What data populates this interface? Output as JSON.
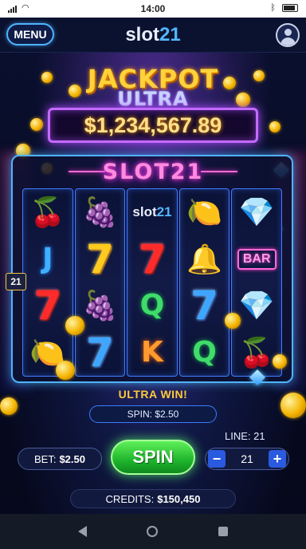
{
  "status": {
    "time": "14:00"
  },
  "header": {
    "menu_label": "MENU",
    "logo_part1": "slot",
    "logo_part2": "21"
  },
  "jackpot": {
    "title": "JACKPOT",
    "subtitle": "ULTRA",
    "amount": "$1,234,567.89"
  },
  "machine": {
    "title": "SLOT21",
    "reels": [
      [
        {
          "type": "fruit",
          "name": "cherries-symbol",
          "glyph": "🍒"
        },
        {
          "type": "letter",
          "text": "J",
          "color": "blue"
        },
        {
          "type": "seven",
          "color": "red"
        },
        {
          "type": "fruit",
          "name": "lemon-symbol",
          "glyph": "🍋"
        }
      ],
      [
        {
          "type": "fruit",
          "name": "grapes-symbol",
          "glyph": "🍇"
        },
        {
          "type": "seven",
          "color": "gold"
        },
        {
          "type": "fruit",
          "name": "grapes-symbol",
          "glyph": "🍇"
        },
        {
          "type": "seven",
          "color": "blue"
        }
      ],
      [
        {
          "type": "logo",
          "a": "slot",
          "b": "21"
        },
        {
          "type": "seven",
          "color": "red"
        },
        {
          "type": "letter",
          "text": "Q",
          "color": "green"
        },
        {
          "type": "letter",
          "text": "K",
          "color": "orange"
        }
      ],
      [
        {
          "type": "fruit",
          "name": "lemon-symbol",
          "glyph": "🍋"
        },
        {
          "type": "fruit",
          "name": "bell-symbol",
          "glyph": "🔔"
        },
        {
          "type": "seven",
          "color": "blue"
        },
        {
          "type": "letter",
          "text": "Q",
          "color": "green"
        }
      ],
      [
        {
          "type": "fruit",
          "name": "diamond-symbol",
          "glyph": "💎"
        },
        {
          "type": "bar",
          "text": "BAR"
        },
        {
          "type": "fruit",
          "name": "diamond-symbol",
          "glyph": "💎"
        },
        {
          "type": "fruit",
          "name": "cherries-symbol",
          "glyph": "🍒"
        }
      ]
    ],
    "payline_marker": "21"
  },
  "win": {
    "label": "ULTRA WIN!",
    "spin_label": "SPIN: $2.50"
  },
  "controls": {
    "bet_label": "BET:",
    "bet_value": "$2.50",
    "spin_button": "SPIN",
    "line_label": "LINE: 21",
    "line_value": "21",
    "minus": "−",
    "plus": "+"
  },
  "credits": {
    "label": "CREDITS:",
    "value": "$150,450"
  }
}
